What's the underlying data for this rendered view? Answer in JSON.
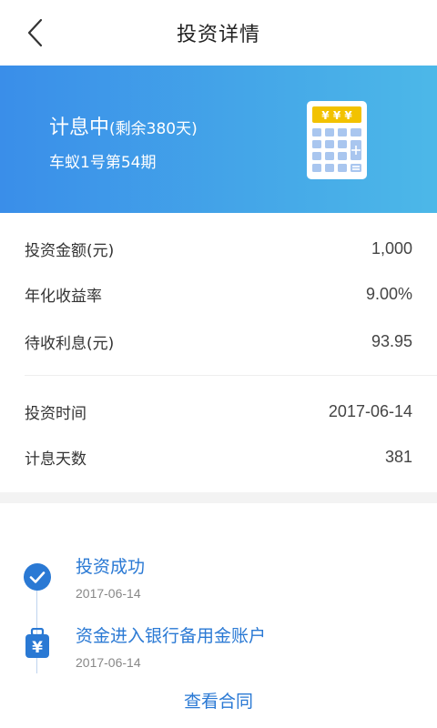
{
  "header": {
    "title": "投资详情"
  },
  "banner": {
    "status": "计息中",
    "remaining": "(剩余380天)",
    "product_name": "车蚁1号第54期",
    "calculator_keys_text": "¥ ¥ ¥",
    "gradient_start": "#3a8ee9",
    "gradient_end": "#4cb8e8"
  },
  "details": {
    "rows": [
      {
        "label": "投资金额(元)",
        "value": "1,000"
      },
      {
        "label": "年化收益率",
        "value": "9.00%"
      },
      {
        "label": "待收利息(元)",
        "value": "93.95"
      },
      {
        "label": "投资时间",
        "value": "2017-06-14"
      },
      {
        "label": "计息天数",
        "value": "381"
      }
    ]
  },
  "timeline": {
    "steps": [
      {
        "title": "投资成功",
        "date": "2017-06-14",
        "icon": "check-circle-icon"
      },
      {
        "title": "资金进入银行备用金账户",
        "date": "2017-06-14",
        "icon": "yuan-bag-icon"
      }
    ]
  },
  "actions": {
    "view_contract": "查看合同"
  },
  "colors": {
    "accent": "#2a79d4",
    "calculator_key": "#a9c6ef",
    "calculator_top": "#f2c200"
  }
}
